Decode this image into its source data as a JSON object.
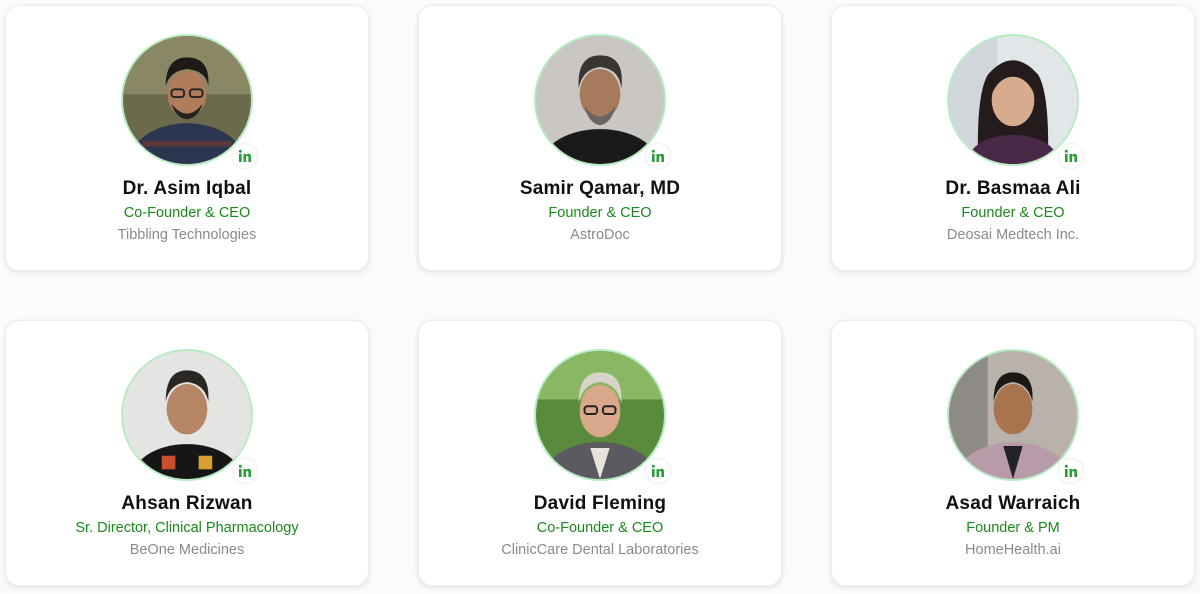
{
  "people": [
    {
      "name": "Dr. Asim Iqbal",
      "role": "Co-Founder & CEO",
      "company": "Tibbling Technologies"
    },
    {
      "name": "Samir Qamar, MD",
      "role": "Founder & CEO",
      "company": "AstroDoc"
    },
    {
      "name": "Dr. Basmaa Ali",
      "role": "Founder & CEO",
      "company": "Deosai Medtech Inc."
    },
    {
      "name": "Ahsan Rizwan",
      "role": "Sr. Director, Clinical Pharmacology",
      "company": "BeOne Medicines"
    },
    {
      "name": "David Fleming",
      "role": "Co-Founder & CEO",
      "company": "ClinicCare Dental Laboratories"
    },
    {
      "name": "Asad Warraich",
      "role": "Founder & PM",
      "company": "HomeHealth.ai"
    }
  ],
  "colors": {
    "role": "#1a8a1a",
    "company": "#8a8a8a",
    "linkedin": "#2a9d3a",
    "avatar_ring": "#b7ecc2"
  },
  "icons": {
    "badge": "linkedin-icon"
  }
}
